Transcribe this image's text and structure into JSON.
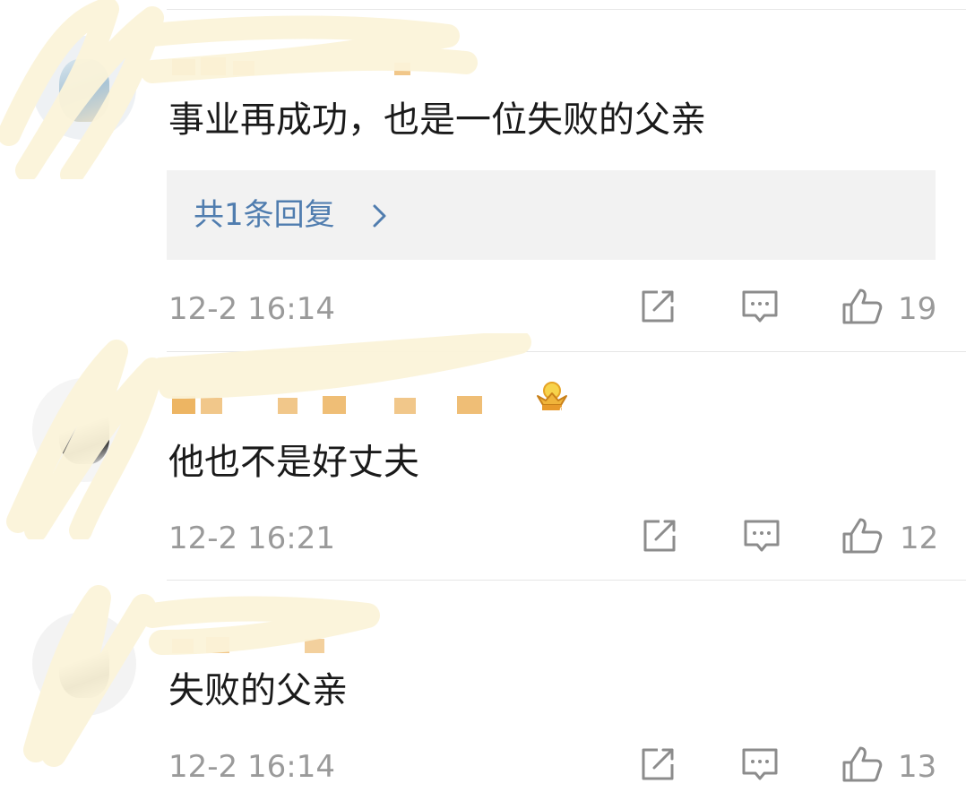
{
  "comments": [
    {
      "text": "事业再成功，也是一位失败的父亲",
      "reply_summary": "共1条回复",
      "timestamp": "12-2 16:14",
      "like_count": "19"
    },
    {
      "text": "他也不是好丈夫",
      "timestamp": "12-2 16:21",
      "like_count": "12"
    },
    {
      "text": "失败的父亲",
      "timestamp": "12-2 16:14",
      "like_count": "13"
    }
  ],
  "icons": {
    "share": "share-icon",
    "comment": "comment-icon",
    "like": "thumbs-up-icon",
    "reply_more": "chevron-right-icon",
    "badge": "crown-badge-icon"
  },
  "colors": {
    "username": "#e8a23c",
    "reply_link": "#507daf",
    "meta_text": "#9a9a9a",
    "icon_stroke": "#8c8c8c",
    "scribble": "#fbf3d9"
  }
}
